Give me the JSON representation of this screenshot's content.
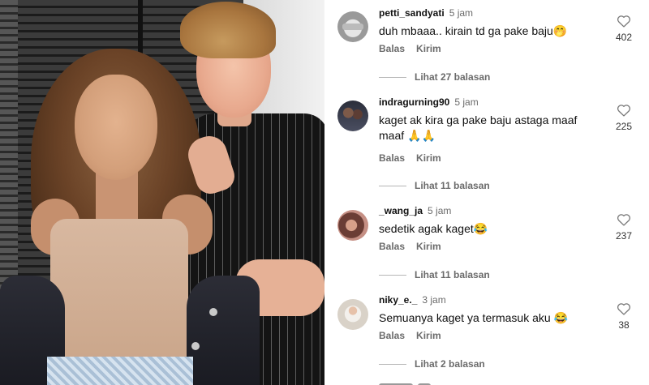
{
  "comments": [
    {
      "username": "petti_sandyati",
      "time": "5 jam",
      "text": "duh mbaaa.. kirain td ga pake baju🤭",
      "reply_label": "Balas",
      "send_label": "Kirim",
      "likes": "402",
      "view_replies": "Lihat 27 balasan"
    },
    {
      "username": "indragurning90",
      "time": "5 jam",
      "text": "kaget ak kira ga pake baju astaga maaf maaf 🙏🙏",
      "reply_label": "Balas",
      "send_label": "Kirim",
      "likes": "225",
      "view_replies": "Lihat 11 balasan"
    },
    {
      "username": "_wang_ja",
      "time": "5 jam",
      "text": "sedetik agak kaget😂",
      "reply_label": "Balas",
      "send_label": "Kirim",
      "likes": "237",
      "view_replies": "Lihat 11 balasan"
    },
    {
      "username": "niky_e._",
      "time": "3 jam",
      "text": "Semuanya kaget ya termasuk aku 😂",
      "reply_label": "Balas",
      "send_label": "Kirim",
      "likes": "38",
      "view_replies": "Lihat 2 balasan"
    }
  ],
  "icons": {
    "like": "heart-outline-icon"
  },
  "colors": {
    "secondary_text": "#6b6b6b",
    "primary_text": "#111111"
  }
}
